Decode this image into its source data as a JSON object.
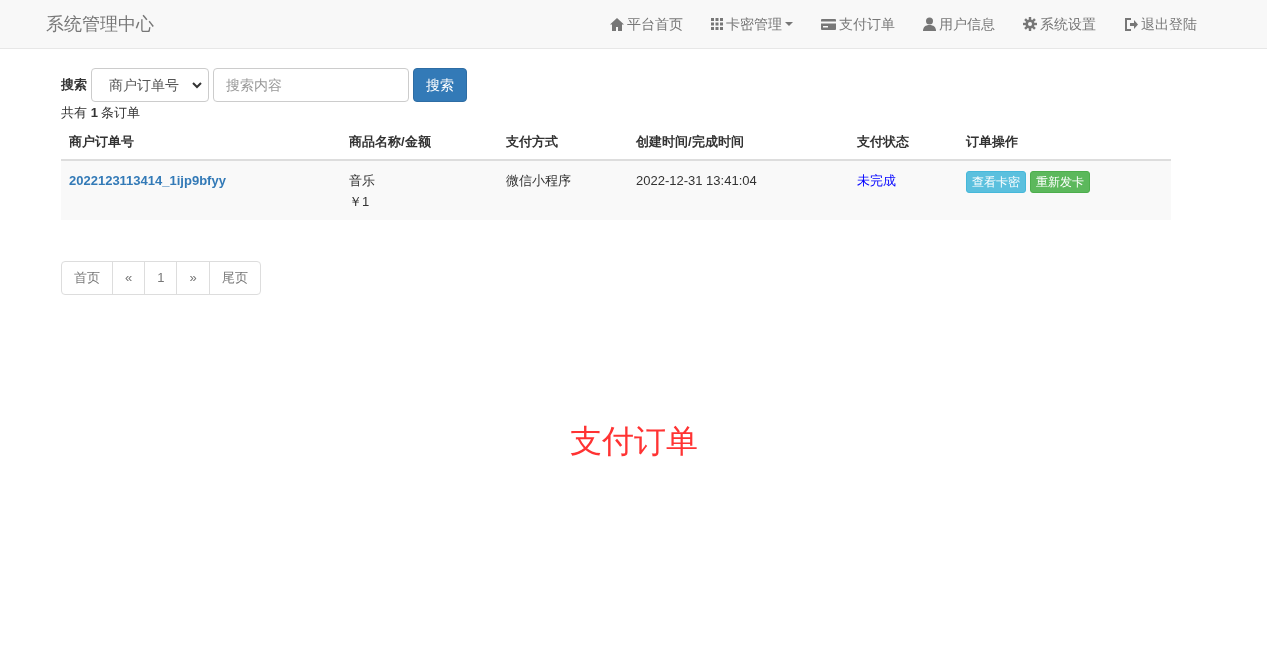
{
  "navbar": {
    "brand": "系统管理中心",
    "items": [
      {
        "label": "平台首页",
        "dropdown": false
      },
      {
        "label": "卡密管理",
        "dropdown": true
      },
      {
        "label": "支付订单",
        "dropdown": false
      },
      {
        "label": "用户信息",
        "dropdown": false
      },
      {
        "label": "系统设置",
        "dropdown": false
      },
      {
        "label": "退出登陆",
        "dropdown": false
      }
    ]
  },
  "search": {
    "label": "搜索",
    "select_value": "商户订单号",
    "placeholder": "搜索内容",
    "button": "搜索"
  },
  "count_text": "共有 **1** 条订单",
  "table": {
    "columns": [
      "商户订单号",
      "商品名称/金额",
      "支付方式",
      "创建时间/完成时间",
      "支付状态",
      "订单操作"
    ],
    "rows": [
      {
        "order_no": "2022123113414_1ijp9bfyy",
        "product": "音乐",
        "amount": "￥1",
        "pay_method": "微信小程序",
        "created": "2022-12-31 13:41:04",
        "status": "未完成",
        "actions": [
          {
            "label": "查看卡密",
            "kind": "info"
          },
          {
            "label": "重新发卡",
            "kind": "success"
          }
        ]
      }
    ]
  },
  "pagination": [
    {
      "label": "首页"
    },
    {
      "label": "«"
    },
    {
      "label": "1"
    },
    {
      "label": "»"
    },
    {
      "label": "尾页"
    }
  ],
  "page_title": "支付订单"
}
